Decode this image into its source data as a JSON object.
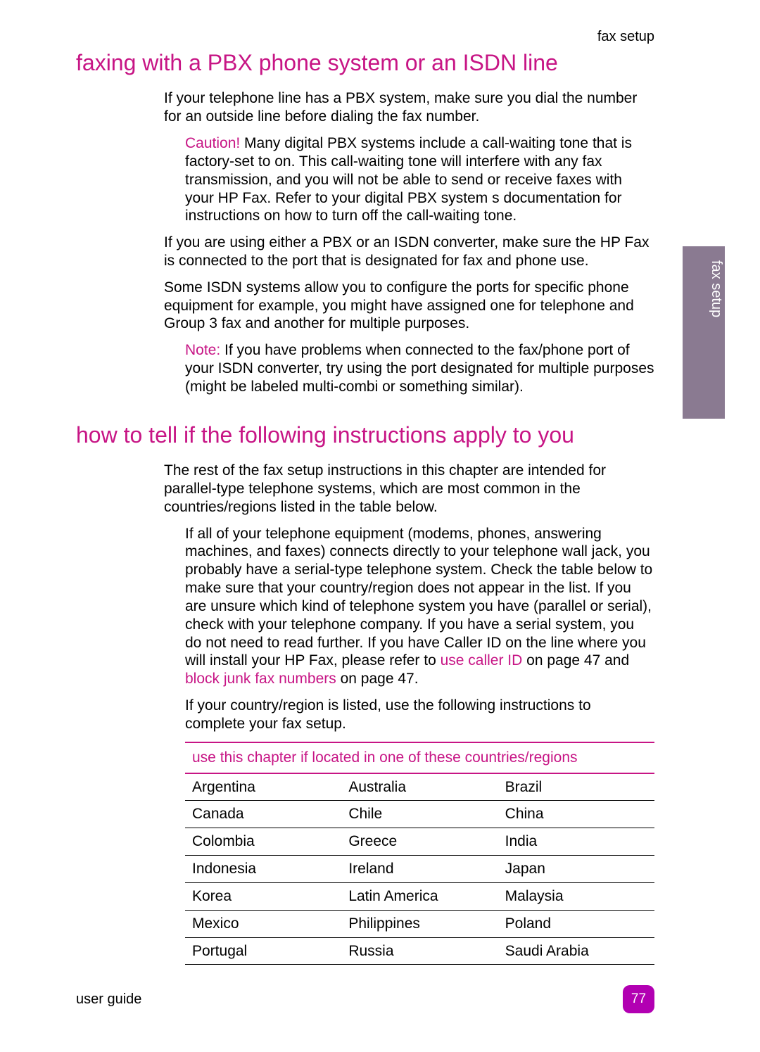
{
  "header": {
    "right": "fax setup"
  },
  "side_tab": "fax setup",
  "h1": "faxing with a PBX phone system or an ISDN line",
  "p1": "If your telephone line has a PBX system, make sure you dial the number for an outside line before dialing the fax number.",
  "caution_label": "Caution!",
  "caution_text": " Many digital PBX systems include a call-waiting tone that is factory-set to on. This call-waiting tone will interfere with any fax transmission, and you will not be able to send or receive faxes with your HP Fax. Refer to your digital PBX system s documentation for instructions on how to turn off the call-waiting tone.",
  "p2": "If you are using either a PBX or an ISDN converter, make sure the HP Fax is connected to the port that is designated for fax and phone use.",
  "p3": "Some ISDN systems allow you to configure the ports for specific phone equipment for example, you might have assigned one for telephone and Group 3 fax and another for multiple purposes.",
  "note_label": "Note:",
  "note_text": " If you have problems when connected to the fax/phone port of your ISDN converter, try using the port designated for multiple purposes (might be labeled multi-combi or something similar).",
  "h2": "how to tell if the following instructions apply to you",
  "p4": "The rest of the fax setup instructions in this chapter are intended for parallel-type telephone systems, which are most common in the countries/regions listed in the table below.",
  "p5a": "If all of your telephone equipment (modems, phones, answering machines, and faxes) connects directly to your telephone wall jack, you probably have a serial-type telephone system. Check the table below to make sure that your country/region does not appear in the list. If you are unsure which kind of telephone system you have (parallel or serial), check with your telephone company. If you have a serial system, you do not need to read further. If you have Caller ID on the line where you will install your HP Fax, please refer to ",
  "link1": "use caller ID",
  "p5b": " on page 47 and ",
  "link2": "block junk fax numbers",
  "p5c": " on page 47.",
  "p6": "If your country/region is listed, use the following instructions to complete your fax setup.",
  "table_header": "use this chapter if located in one of these countries/regions",
  "countries": [
    [
      "Argentina",
      "Australia",
      "Brazil"
    ],
    [
      "Canada",
      "Chile",
      "China"
    ],
    [
      "Colombia",
      "Greece",
      "India"
    ],
    [
      "Indonesia",
      "Ireland",
      "Japan"
    ],
    [
      "Korea",
      "Latin America",
      "Malaysia"
    ],
    [
      "Mexico",
      "Philippines",
      "Poland"
    ],
    [
      "Portugal",
      "Russia",
      "Saudi Arabia"
    ]
  ],
  "footer": {
    "left": "user guide",
    "page": "77"
  }
}
